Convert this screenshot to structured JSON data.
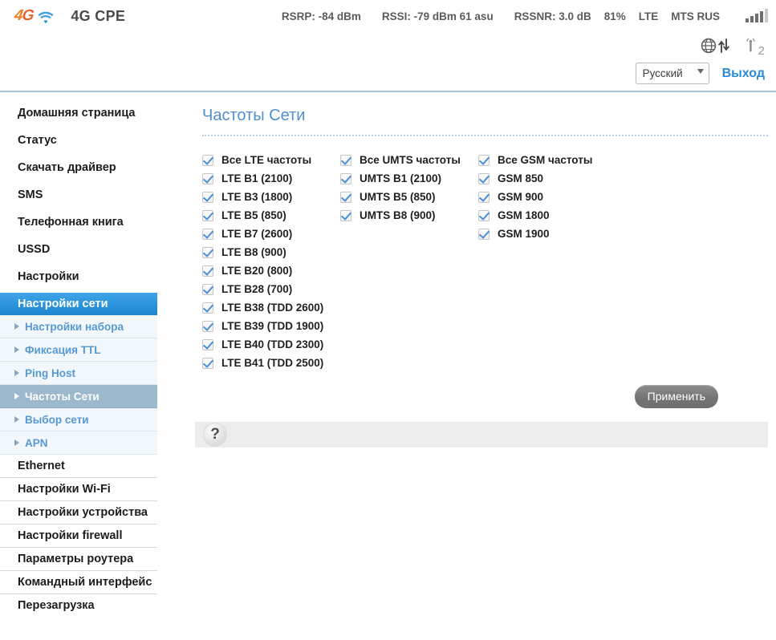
{
  "header": {
    "logo_text_4": "4",
    "logo_text_g": "G",
    "wifi_icon": "wifi-icon",
    "brand_title": "4G CPE",
    "metrics": {
      "rsrp": "RSRP: -84 dBm",
      "rssi": "RSSI: -79 dBm 61 asu",
      "rssnr": "RSSNR: 3.0 dB",
      "battery": "81%",
      "network_type": "LTE",
      "operator": "MTS RUS"
    },
    "signal_bars_icon": "signal-bars-icon",
    "globe_icon": "globe-icon",
    "transfer_icon": "up-down-arrows-icon",
    "antenna_icon": "antenna-icon",
    "antenna_count": "2",
    "language": {
      "selected": "Русский",
      "options": [
        "Русский"
      ]
    },
    "logout_label": "Выход"
  },
  "sidebar": {
    "items": [
      {
        "label": "Домашняя страница",
        "type": "main",
        "active": false
      },
      {
        "label": "Статус",
        "type": "main",
        "active": false
      },
      {
        "label": "Скачать драйвер",
        "type": "main",
        "active": false
      },
      {
        "label": "SMS",
        "type": "main",
        "active": false
      },
      {
        "label": "Телефонная книга",
        "type": "main",
        "active": false
      },
      {
        "label": "USSD",
        "type": "main",
        "active": false
      },
      {
        "label": "Настройки",
        "type": "main",
        "active": false
      },
      {
        "label": "Настройки сети",
        "type": "main-active",
        "active": true
      },
      {
        "label": "Настройки набора",
        "type": "sub",
        "active": false
      },
      {
        "label": "Фиксация TTL",
        "type": "sub",
        "active": false
      },
      {
        "label": "Ping Host",
        "type": "sub",
        "active": false
      },
      {
        "label": "Частоты Сети",
        "type": "sub",
        "active": true
      },
      {
        "label": "Выбор сети",
        "type": "sub",
        "active": false
      },
      {
        "label": "APN",
        "type": "sub",
        "active": false
      },
      {
        "label": "Ethernet",
        "type": "bordered",
        "active": false
      },
      {
        "label": "Настройки Wi-Fi",
        "type": "bordered",
        "active": false
      },
      {
        "label": "Настройки устройства",
        "type": "bordered",
        "active": false
      },
      {
        "label": "Настройки firewall",
        "type": "bordered",
        "active": false
      },
      {
        "label": "Параметры роутера",
        "type": "bordered",
        "active": false
      },
      {
        "label": "Командный интерфейс",
        "type": "bordered",
        "active": false
      },
      {
        "label": "Перезагрузка",
        "type": "main",
        "active": false
      }
    ]
  },
  "main": {
    "page_title": "Частоты Сети",
    "lte_column": [
      {
        "label": "Все LTE частоты",
        "checked": true
      },
      {
        "label": "LTE B1 (2100)",
        "checked": true
      },
      {
        "label": "LTE B3 (1800)",
        "checked": true
      },
      {
        "label": "LTE B5 (850)",
        "checked": true
      },
      {
        "label": "LTE B7 (2600)",
        "checked": true
      },
      {
        "label": "LTE B8 (900)",
        "checked": true
      },
      {
        "label": "LTE B20 (800)",
        "checked": true
      },
      {
        "label": "LTE B28 (700)",
        "checked": true
      },
      {
        "label": "LTE B38 (TDD 2600)",
        "checked": true
      },
      {
        "label": "LTE B39 (TDD 1900)",
        "checked": true
      },
      {
        "label": "LTE B40 (TDD 2300)",
        "checked": true
      },
      {
        "label": "LTE B41 (TDD 2500)",
        "checked": true
      }
    ],
    "umts_column": [
      {
        "label": "Все UMTS частоты",
        "checked": true
      },
      {
        "label": "UMTS B1 (2100)",
        "checked": true
      },
      {
        "label": "UMTS B5 (850)",
        "checked": true
      },
      {
        "label": "UMTS B8 (900)",
        "checked": true
      }
    ],
    "gsm_column": [
      {
        "label": "Все GSM частоты",
        "checked": true
      },
      {
        "label": "GSM 850",
        "checked": true
      },
      {
        "label": "GSM 900",
        "checked": true
      },
      {
        "label": "GSM 1800",
        "checked": true
      },
      {
        "label": "GSM 1900",
        "checked": true
      }
    ],
    "apply_label": "Применить",
    "help_icon_label": "?"
  },
  "colors": {
    "accent_blue": "#2a8ad4",
    "title_blue": "#4f8fcd",
    "orange_logo": "#f07d22",
    "sub_active_bg": "#9cb8cc"
  }
}
